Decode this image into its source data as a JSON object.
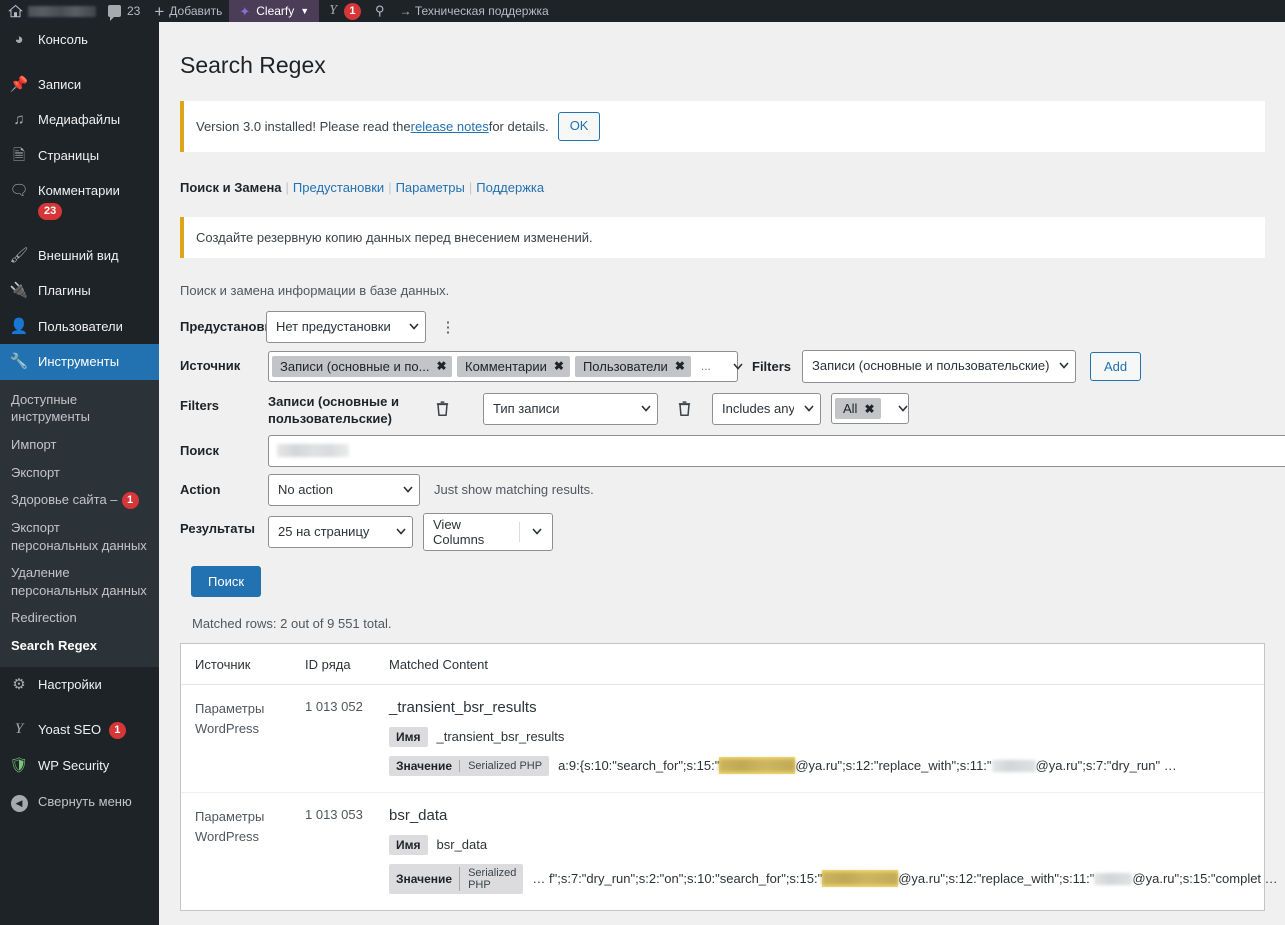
{
  "adminbar": {
    "home_icon": "home-icon",
    "site_title_redacted": true,
    "comments_icon": "comment-bubble-icon",
    "comments_count": "23",
    "add_plus": "+",
    "add_label": "Добавить",
    "clearfy_label": "Clearfy",
    "clearfy_chevron": "▼",
    "yoast_label": "Y",
    "yoast_count": "1",
    "search_icon": "search-icon",
    "support_label": "→ Техническая поддержка"
  },
  "sidebar": {
    "top_items": [
      {
        "label": "Консоль",
        "icon": "dashboard-icon"
      },
      {
        "label": "Записи",
        "icon": "pin-icon"
      },
      {
        "label": "Медиафайлы",
        "icon": "media-icon"
      },
      {
        "label": "Страницы",
        "icon": "pages-icon"
      },
      {
        "label": "Комментарии",
        "icon": "comments-icon",
        "badge": "23"
      },
      {
        "label": "Внешний вид",
        "icon": "appearance-brush-icon"
      },
      {
        "label": "Плагины",
        "icon": "plugins-plug-icon"
      },
      {
        "label": "Пользователи",
        "icon": "users-icon"
      },
      {
        "label": "Инструменты",
        "icon": "tools-wrench-icon",
        "current": true
      }
    ],
    "submenu": [
      {
        "label": "Доступные инструменты"
      },
      {
        "label": "Импорт"
      },
      {
        "label": "Экспорт"
      },
      {
        "label": "Здоровье сайта –",
        "badge": "1"
      },
      {
        "label": "Экспорт персональных данных"
      },
      {
        "label": "Удаление персональных данных"
      },
      {
        "label": "Redirection"
      },
      {
        "label": "Search Regex",
        "active": true
      }
    ],
    "bottom_items": [
      {
        "label": "Настройки",
        "icon": "settings-sliders-icon"
      },
      {
        "label": "Yoast SEO",
        "icon": "yoast-icon",
        "badge": "1"
      },
      {
        "label": "WP Security",
        "icon": "shield-icon"
      },
      {
        "label": "Свернуть меню",
        "icon": "collapse-arrow-icon"
      }
    ]
  },
  "page": {
    "title": "Search Regex",
    "notice_version": {
      "text_before": "Version 3.0 installed! Please read the ",
      "link": "release notes",
      "text_after": " for details.",
      "ok_label": "OK"
    },
    "tabs": [
      {
        "label": "Поиск и Замена",
        "current": true
      },
      {
        "label": "Предустановки"
      },
      {
        "label": "Параметры"
      },
      {
        "label": "Поддержка"
      }
    ],
    "tab_separator": "|",
    "notice_backup": "Создайте резервную копию данных перед внесением изменений.",
    "intro": "Поиск и замена информации в базе данных."
  },
  "form": {
    "preset": {
      "label": "Предустановки",
      "value": "Нет предустановки",
      "menu_icon": "vertical-dots-icon"
    },
    "source": {
      "label": "Источник",
      "tags": [
        {
          "label": "Записи (основные и по..."
        },
        {
          "label": "Комментарии"
        },
        {
          "label": "Пользователи"
        }
      ],
      "overflow": "...",
      "filters_label": "Filters",
      "filters_value": "Записи (основные и пользовательские)",
      "add_label": "Add"
    },
    "filters": {
      "label": "Filters",
      "group_title": "Записи (основные и пользовательские)",
      "delete_icon": "trash-icon",
      "field_value": "Тип записи",
      "delete_icon_2": "trash-icon",
      "operator_value": "Includes any",
      "value_tag": "All"
    },
    "search": {
      "label": "Поиск",
      "value_redacted": true
    },
    "action": {
      "label": "Action",
      "value": "No action",
      "hint": "Just show matching results."
    },
    "results_opts": {
      "label": "Результаты",
      "per_page": "25 на страницу",
      "view_columns": "View Columns"
    },
    "submit_label": "Поиск"
  },
  "results": {
    "matched_line": "Matched rows: 2 out of 9 551 total.",
    "columns": [
      "Источник",
      "ID ряда",
      "Matched Content"
    ],
    "rows": [
      {
        "source": "Параметры WordPress",
        "row_id": "1 013 052",
        "title": "_transient_bsr_results",
        "name_chip": "Имя",
        "name_value": "_transient_bsr_results",
        "value_chip": "Значение",
        "value_type": "Serialized PHP",
        "value_before": "a:9:{s:10:\"search_for\";s:15:\"",
        "value_after": "@ya.ru\";s:12:\"replace_with\";s:11:\"",
        "value_tail": "@ya.ru\";s:7:\"dry_run\" …"
      },
      {
        "source": "Параметры WordPress",
        "row_id": "1 013 053",
        "title": "bsr_data",
        "name_chip": "Имя",
        "name_value": "bsr_data",
        "value_chip": "Значение",
        "value_type": "Serialized PHP",
        "value_before": "… f\";s:7:\"dry_run\";s:2:\"on\";s:10:\"search_for\";s:15:\"",
        "value_after": "@ya.ru\";s:12:\"replace_with\";s:11:\"",
        "value_tail": "@ya.ru\";s:15:\"complet …"
      }
    ]
  },
  "colors": {
    "wp_blue": "#2271b1",
    "admin_dark": "#1d2327",
    "submenu_bg": "#2c3338",
    "notice_amber": "#dba617",
    "badge_red": "#d63638",
    "highlight_yellow": "#f5d76e",
    "page_bg": "#f0f0f1"
  }
}
